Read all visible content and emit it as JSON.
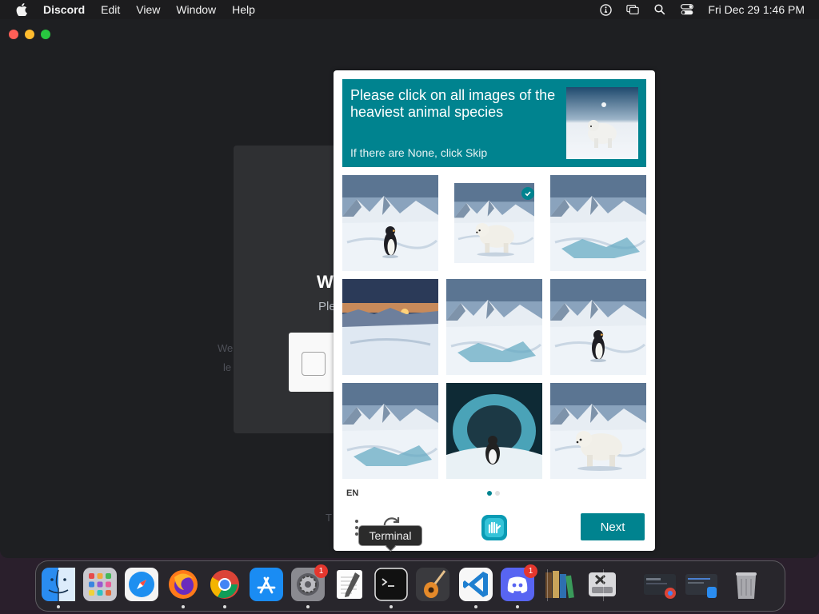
{
  "menubar": {
    "app_name": "Discord",
    "items": [
      "Edit",
      "View",
      "Window",
      "Help"
    ],
    "clock": "Fri Dec 29  1:46 PM"
  },
  "discord": {
    "welcome_fragment": "W",
    "please_fragment": "Ple",
    "faint_line_1": "We",
    "faint_line_2": "le",
    "faint_line_3": "T"
  },
  "captcha": {
    "prompt": "Please click on all images of the heaviest animal species",
    "skip_hint": "If there are None, click Skip",
    "language": "EN",
    "next_label": "Next",
    "tiles": [
      {
        "subject": "penguin",
        "selected": false
      },
      {
        "subject": "polar-bear",
        "selected": true
      },
      {
        "subject": "ice",
        "selected": false
      },
      {
        "subject": "sunset-ice",
        "selected": false
      },
      {
        "subject": "ice",
        "selected": false
      },
      {
        "subject": "penguin",
        "selected": false
      },
      {
        "subject": "ice",
        "selected": false
      },
      {
        "subject": "penguin-cave",
        "selected": false
      },
      {
        "subject": "polar-bear",
        "selected": false
      }
    ],
    "page_dots": 2,
    "active_dot": 0,
    "accent": "#00838f"
  },
  "tooltip": {
    "text": "Terminal"
  },
  "dock": {
    "apps": [
      {
        "name": "Finder",
        "badge": ""
      },
      {
        "name": "Launchpad",
        "badge": ""
      },
      {
        "name": "Safari",
        "badge": ""
      },
      {
        "name": "Firefox",
        "badge": ""
      },
      {
        "name": "Chrome",
        "badge": ""
      },
      {
        "name": "App Store",
        "badge": ""
      },
      {
        "name": "System Settings",
        "badge": "1"
      },
      {
        "name": "TextEdit",
        "badge": ""
      },
      {
        "name": "Terminal",
        "badge": ""
      },
      {
        "name": "GarageBand",
        "badge": ""
      },
      {
        "name": "VS Code",
        "badge": ""
      },
      {
        "name": "Discord",
        "badge": "1"
      },
      {
        "name": "Calibre",
        "badge": ""
      },
      {
        "name": "Disk Utility",
        "badge": ""
      },
      {
        "name": "Chrome Window",
        "badge": ""
      },
      {
        "name": "Finder Window",
        "badge": ""
      },
      {
        "name": "Trash",
        "badge": ""
      }
    ]
  }
}
